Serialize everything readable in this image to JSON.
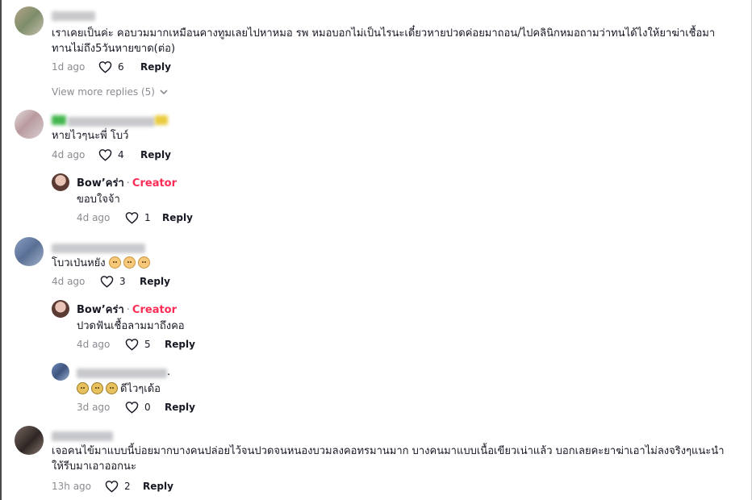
{
  "colors": {
    "creator": "#fe2c55",
    "muted": "#8a8b91",
    "text": "#161823"
  },
  "comments": [
    {
      "text": "เราเคยเป็นค่ะ คอบวมมากเหมือนคางทูมเลยไปหาหมอ รพ หมอบอกไม่เป็นไรนะเดี๋ยวหายปวดค่อยมาถอน/ไปคลินิกหมอถามว่าทนได้ไงให้ยาฆ่าเชื้อมา",
      "text2": "ทานไม่ถึง5วันหายขาด(ต่อ)",
      "time": "1d ago",
      "likes": "6",
      "reply": "Reply",
      "view_more": "View more replies (5)"
    },
    {
      "text": "หายไวๆนะพี่ โบว์",
      "time": "4d ago",
      "likes": "4",
      "reply": "Reply",
      "creator_reply": {
        "author": "Bow’คร่า",
        "dot": "·",
        "badge": "Creator",
        "text": "ขอบใจจ้า",
        "time": "4d ago",
        "likes": "1",
        "reply": "Reply"
      }
    },
    {
      "text": "โบวเป่นหยัง",
      "time": "4d ago",
      "likes": "3",
      "reply": "Reply",
      "creator_reply": {
        "author": "Bow’คร่า",
        "dot": "·",
        "badge": "Creator",
        "text": "ปวดฟันเชื้อลามมาถึงคอ",
        "time": "4d ago",
        "likes": "5",
        "reply": "Reply"
      },
      "sub_reply": {
        "name_suffix": ".",
        "text": "ดีไวๆเด้อ",
        "time": "3d ago",
        "likes": "0",
        "reply": "Reply"
      }
    },
    {
      "text": "เจอคนไข้มาแบบนี้บ่อยมากบางคนปล่อยไว้จนปวดจนหนองบวมลงคอทรมานมาก บางคนมาแบบเนื้อเขียวเน่าแล้ว บอกเลยคะยาฆ่าเอาไม่ลงจริงๆแนะนำ",
      "text2": "ให้รีบมาเอาออกนะ",
      "time": "13h ago",
      "likes": "2",
      "reply": "Reply"
    }
  ],
  "icons": {
    "heart": "heart-icon",
    "chevron": "chevron-down-icon",
    "emoji_sweat": "sweat-smile-emoji",
    "emoji_sad": "sad-face-emoji"
  }
}
